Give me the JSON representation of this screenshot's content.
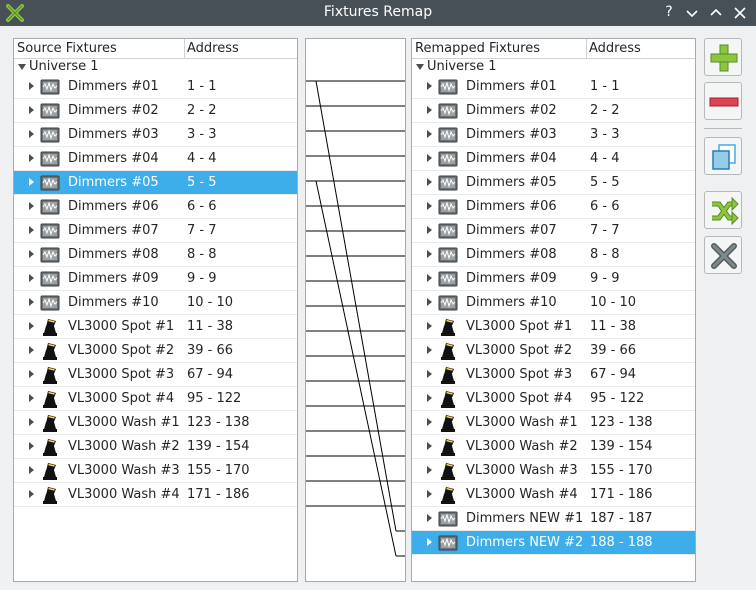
{
  "window": {
    "title": "Fixtures Remap",
    "help_label": "?"
  },
  "source": {
    "col1": "Source Fixtures",
    "col2": "Address",
    "universe": "Universe 1",
    "rows": [
      {
        "name": "Dimmers #01",
        "addr": "1 - 1",
        "icon": "dimmer-icon"
      },
      {
        "name": "Dimmers #02",
        "addr": "2 - 2",
        "icon": "dimmer-icon"
      },
      {
        "name": "Dimmers #03",
        "addr": "3 - 3",
        "icon": "dimmer-icon"
      },
      {
        "name": "Dimmers #04",
        "addr": "4 - 4",
        "icon": "dimmer-icon"
      },
      {
        "name": "Dimmers #05",
        "addr": "5 - 5",
        "icon": "dimmer-icon",
        "selected": true
      },
      {
        "name": "Dimmers #06",
        "addr": "6 - 6",
        "icon": "dimmer-icon"
      },
      {
        "name": "Dimmers #07",
        "addr": "7 - 7",
        "icon": "dimmer-icon"
      },
      {
        "name": "Dimmers #08",
        "addr": "8 - 8",
        "icon": "dimmer-icon"
      },
      {
        "name": "Dimmers #09",
        "addr": "9 - 9",
        "icon": "dimmer-icon"
      },
      {
        "name": "Dimmers #10",
        "addr": "10 - 10",
        "icon": "dimmer-icon"
      },
      {
        "name": "VL3000 Spot #1",
        "addr": "11 - 38",
        "icon": "moving-head-icon"
      },
      {
        "name": "VL3000 Spot #2",
        "addr": "39 - 66",
        "icon": "moving-head-icon"
      },
      {
        "name": "VL3000 Spot #3",
        "addr": "67 - 94",
        "icon": "moving-head-icon"
      },
      {
        "name": "VL3000 Spot #4",
        "addr": "95 - 122",
        "icon": "moving-head-icon"
      },
      {
        "name": "VL3000 Wash #1",
        "addr": "123 - 138",
        "icon": "moving-head-icon"
      },
      {
        "name": "VL3000 Wash #2",
        "addr": "139 - 154",
        "icon": "moving-head-icon"
      },
      {
        "name": "VL3000 Wash #3",
        "addr": "155 - 170",
        "icon": "moving-head-icon"
      },
      {
        "name": "VL3000 Wash #4",
        "addr": "171 - 186",
        "icon": "moving-head-icon"
      }
    ]
  },
  "target": {
    "col1": "Remapped Fixtures",
    "col2": "Address",
    "universe": "Universe 1",
    "rows": [
      {
        "name": "Dimmers #01",
        "addr": "1 - 1",
        "icon": "dimmer-icon"
      },
      {
        "name": "Dimmers #02",
        "addr": "2 - 2",
        "icon": "dimmer-icon"
      },
      {
        "name": "Dimmers #03",
        "addr": "3 - 3",
        "icon": "dimmer-icon"
      },
      {
        "name": "Dimmers #04",
        "addr": "4 - 4",
        "icon": "dimmer-icon"
      },
      {
        "name": "Dimmers #05",
        "addr": "5 - 5",
        "icon": "dimmer-icon"
      },
      {
        "name": "Dimmers #06",
        "addr": "6 - 6",
        "icon": "dimmer-icon"
      },
      {
        "name": "Dimmers #07",
        "addr": "7 - 7",
        "icon": "dimmer-icon"
      },
      {
        "name": "Dimmers #08",
        "addr": "8 - 8",
        "icon": "dimmer-icon"
      },
      {
        "name": "Dimmers #09",
        "addr": "9 - 9",
        "icon": "dimmer-icon"
      },
      {
        "name": "Dimmers #10",
        "addr": "10 - 10",
        "icon": "dimmer-icon"
      },
      {
        "name": "VL3000 Spot #1",
        "addr": "11 - 38",
        "icon": "moving-head-icon"
      },
      {
        "name": "VL3000 Spot #2",
        "addr": "39 - 66",
        "icon": "moving-head-icon"
      },
      {
        "name": "VL3000 Spot #3",
        "addr": "67 - 94",
        "icon": "moving-head-icon"
      },
      {
        "name": "VL3000 Spot #4",
        "addr": "95 - 122",
        "icon": "moving-head-icon"
      },
      {
        "name": "VL3000 Wash #1",
        "addr": "123 - 138",
        "icon": "moving-head-icon"
      },
      {
        "name": "VL3000 Wash #2",
        "addr": "139 - 154",
        "icon": "moving-head-icon"
      },
      {
        "name": "VL3000 Wash #3",
        "addr": "155 - 170",
        "icon": "moving-head-icon"
      },
      {
        "name": "VL3000 Wash #4",
        "addr": "171 - 186",
        "icon": "moving-head-icon"
      },
      {
        "name": "Dimmers NEW #1",
        "addr": "187 - 187",
        "icon": "dimmer-icon"
      },
      {
        "name": "Dimmers NEW #2",
        "addr": "188 - 188",
        "icon": "dimmer-icon",
        "selected": true
      }
    ]
  },
  "mappings": [
    {
      "from": 0,
      "to": 18
    },
    {
      "from": 4,
      "to": 19
    }
  ],
  "toolbar": [
    {
      "name": "add-remap-button",
      "icon": "plus-icon"
    },
    {
      "name": "remove-remap-button",
      "icon": "minus-icon"
    },
    {
      "name": "clone-button",
      "icon": "clone-icon"
    },
    {
      "name": "auto-remap-button",
      "icon": "shuffle-icon"
    },
    {
      "name": "clear-remap-button",
      "icon": "close-icon"
    }
  ],
  "colors": {
    "titlebar": "#475057",
    "selection": "#3daee9",
    "accent_green": "#8cc63f",
    "remove_red": "#da4453",
    "clone_blue": "#3daee9"
  }
}
